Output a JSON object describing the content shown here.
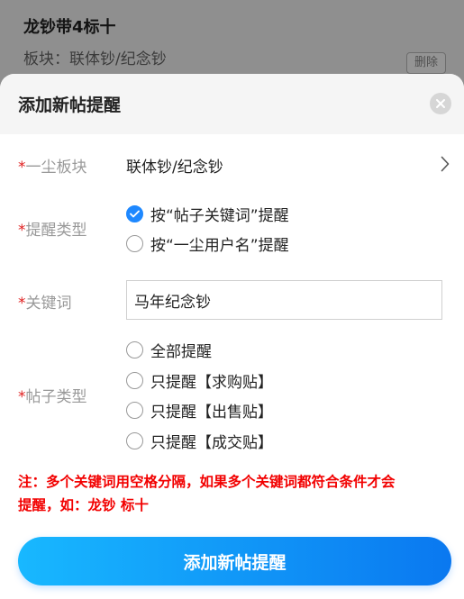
{
  "background": {
    "title": "龙钞带4标十",
    "subtitle": "板块：联体钞/纪念钞",
    "delete_label": "删除"
  },
  "sheet": {
    "title": "添加新帖提醒"
  },
  "form": {
    "section": {
      "required": "*",
      "label": "一尘板块",
      "value": "联体钞/纪念钞"
    },
    "remind_type": {
      "required": "*",
      "label": "提醒类型",
      "options": [
        {
          "label": "按“帖子关键词”提醒",
          "checked": true
        },
        {
          "label": "按“一尘用户名”提醒",
          "checked": false
        }
      ]
    },
    "keyword": {
      "required": "*",
      "label": "关键词",
      "value": "马年纪念钞"
    },
    "post_type": {
      "required": "*",
      "label": "帖子类型",
      "options": [
        {
          "label": "全部提醒",
          "checked": false
        },
        {
          "label": "只提醒【求购贴】",
          "checked": false
        },
        {
          "label": "只提醒【出售贴】",
          "checked": false
        },
        {
          "label": "只提醒【成交贴】",
          "checked": false
        }
      ]
    },
    "note_line1": "注：多个关键词用空格分隔，如果多个关键词都符合条件才会",
    "note_line2": "提醒，如：龙钞 标十"
  },
  "submit_label": "添加新帖提醒",
  "colors": {
    "accent": "#1e88ff",
    "required": "#e02020",
    "note": "#f20000"
  },
  "icons": [
    "close-icon",
    "chevron-right-icon",
    "check-icon"
  ]
}
